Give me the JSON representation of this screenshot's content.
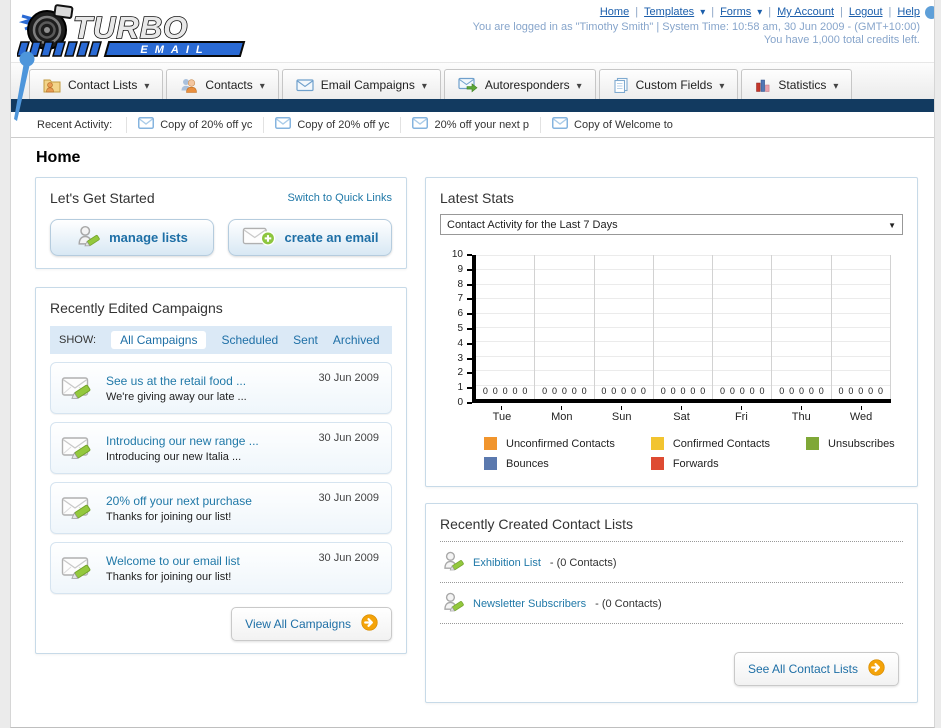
{
  "header": {
    "logo_title": "TURBO",
    "logo_subtitle": "EMAIL",
    "nav_links": {
      "home": "Home",
      "templates": "Templates",
      "forms": "Forms",
      "my_account": "My Account",
      "logout": "Logout",
      "help": "Help"
    },
    "status_line1": "You are logged in as \"Timothy Smith\" | System Time: 10:58 am, 30 Jun 2009 - (GMT+10:00)",
    "status_line2": "You have 1,000 total credits left."
  },
  "tabs": [
    {
      "label": "Contact Lists"
    },
    {
      "label": "Contacts"
    },
    {
      "label": "Email Campaigns"
    },
    {
      "label": "Autoresponders"
    },
    {
      "label": "Custom Fields"
    },
    {
      "label": "Statistics"
    }
  ],
  "recent_activity": {
    "label": "Recent Activity:",
    "items": [
      "Copy of 20% off yc",
      "Copy of 20% off yc",
      "20% off your next p",
      "Copy of Welcome to"
    ]
  },
  "page_title": "Home",
  "get_started": {
    "title": "Let's Get Started",
    "switch_link": "Switch to Quick Links",
    "manage_lists_label": "manage lists",
    "create_email_label": "create an email"
  },
  "campaigns": {
    "title": "Recently Edited Campaigns",
    "show_label": "SHOW:",
    "filters": [
      "All Campaigns",
      "Scheduled",
      "Sent",
      "Archived"
    ],
    "active_filter": "All Campaigns",
    "items": [
      {
        "title": "See us at the retail food ...",
        "subtitle": "We're giving away our late ...",
        "date": "30 Jun 2009"
      },
      {
        "title": "Introducing our new range ...",
        "subtitle": "Introducing our new Italia ...",
        "date": "30 Jun 2009"
      },
      {
        "title": "20% off your next purchase",
        "subtitle": "Thanks for joining our list!",
        "date": "30 Jun 2009"
      },
      {
        "title": "Welcome to our email list",
        "subtitle": "Thanks for joining our list!",
        "date": "30 Jun 2009"
      }
    ],
    "view_all_label": "View All Campaigns"
  },
  "stats": {
    "title": "Latest Stats",
    "dropdown_value": "Contact Activity for the Last 7 Days"
  },
  "chart_data": {
    "type": "bar",
    "title": "Contact Activity for the Last 7 Days",
    "categories": [
      "Tue",
      "Mon",
      "Sun",
      "Sat",
      "Fri",
      "Thu",
      "Wed"
    ],
    "series": [
      {
        "name": "Unconfirmed Contacts",
        "color": "#F1952D",
        "values": [
          0,
          0,
          0,
          0,
          0,
          0,
          0
        ]
      },
      {
        "name": "Confirmed Contacts",
        "color": "#F2C430",
        "values": [
          0,
          0,
          0,
          0,
          0,
          0,
          0
        ]
      },
      {
        "name": "Unsubscribes",
        "color": "#7FA837",
        "values": [
          0,
          0,
          0,
          0,
          0,
          0,
          0
        ]
      },
      {
        "name": "Bounces",
        "color": "#5B79AE",
        "values": [
          0,
          0,
          0,
          0,
          0,
          0,
          0
        ]
      },
      {
        "name": "Forwards",
        "color": "#DE4B32",
        "values": [
          0,
          0,
          0,
          0,
          0,
          0,
          0
        ]
      }
    ],
    "xlabel": "",
    "ylabel": "",
    "ylim": [
      0,
      10
    ],
    "ytick_step": 1,
    "grid": true,
    "legend_position": "bottom"
  },
  "contact_lists": {
    "title": "Recently Created Contact Lists",
    "items": [
      {
        "name": "Exhibition List",
        "count": "- (0 Contacts)"
      },
      {
        "name": "Newsletter Subscribers",
        "count": "- (0 Contacts)"
      }
    ],
    "see_all_label": "See All Contact Lists"
  }
}
